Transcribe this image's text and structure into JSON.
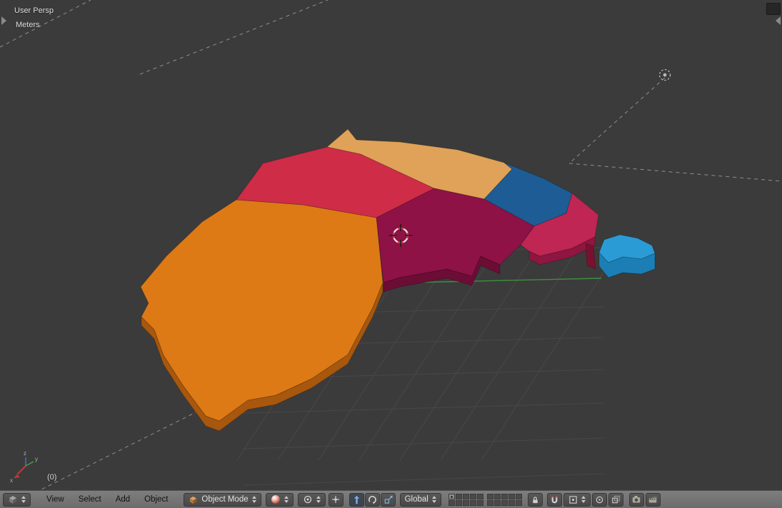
{
  "viewport": {
    "view_label": "User Persp",
    "units_label": "Meters",
    "object_info": "(0)",
    "colors": {
      "background": "#3b3b3b",
      "grid_line": "#484848",
      "y_axis": "#3f8f3f",
      "dashed_line": "#8f8f8f",
      "cursor_red": "#cc3535",
      "cursor_white": "#e6e6e6",
      "cursor_tick": "#1a1a1a",
      "lamp": "#b8b8b8"
    },
    "mini_axis_labels": {
      "x": "x",
      "y": "y",
      "z": "z"
    }
  },
  "map": {
    "regions": [
      {
        "name": "region-west-orange",
        "fill": "#DD7A16",
        "side": "#A8570E"
      },
      {
        "name": "region-north-red",
        "fill": "#CE2C47"
      },
      {
        "name": "region-northeast-tan",
        "fill": "#DFA258"
      },
      {
        "name": "region-center-maroon",
        "fill": "#8E1245",
        "side": "#6B0D35"
      },
      {
        "name": "region-east-blue",
        "fill": "#1D5C95"
      },
      {
        "name": "region-southeast-crimson",
        "fill": "#C02653",
        "side": "#8E1640"
      },
      {
        "name": "island-lightblue",
        "fill": "#2B9BD6",
        "side": "#1B7FB5"
      },
      {
        "name": "sliver-dark",
        "fill": "#7A1030"
      }
    ]
  },
  "header": {
    "menus": [
      "View",
      "Select",
      "Add",
      "Object"
    ],
    "mode_select": {
      "value": "Object Mode"
    },
    "orientation_select": {
      "value": "Global"
    },
    "icons": {
      "editor_type": "3d-viewport-cube",
      "mode": "object-cube",
      "shading": "sphere",
      "pivot": "circle-dot",
      "manipulators": [
        "translate-arrow",
        "rotate-arc",
        "scale-square"
      ],
      "snap": "magnet",
      "render": [
        "camera-still",
        "film-animation"
      ]
    }
  }
}
